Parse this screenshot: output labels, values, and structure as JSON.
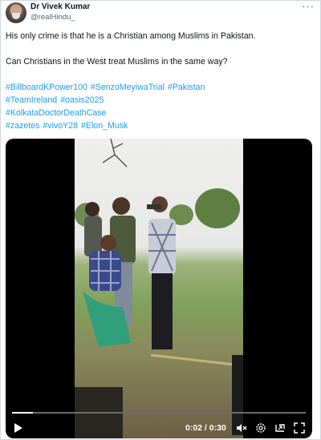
{
  "author": {
    "name": "Dr Vivek Kumar",
    "handle": "@realHindu_"
  },
  "tweet": {
    "line1": "His only crime is that he is a Christian among Muslims in Pakistan.",
    "line2": "Can Christians in the West treat Muslims in the same way?",
    "hashtag_lines": [
      [
        "#BillboardKPower100",
        "#SenzoMeyiwaTrial",
        "#Pakistan"
      ],
      [
        "#TeamIreland",
        "#oasis2025"
      ],
      [
        "#KolkataDoctorDeathCase"
      ],
      [
        "#zazetes",
        "#vivoY28",
        "#Elon_Musk"
      ]
    ]
  },
  "video": {
    "time": "0:02 / 0:30",
    "progress": 0.07
  },
  "icons": {
    "more": "more-options-icon",
    "play": "play-icon",
    "mute": "volume-muted-icon",
    "settings": "settings-gear-icon",
    "pip": "picture-in-picture-icon",
    "fullscreen": "fullscreen-icon"
  },
  "colors": {
    "link": "#1d9bf0",
    "secondary_text": "#536471",
    "video_bg": "#000000"
  }
}
